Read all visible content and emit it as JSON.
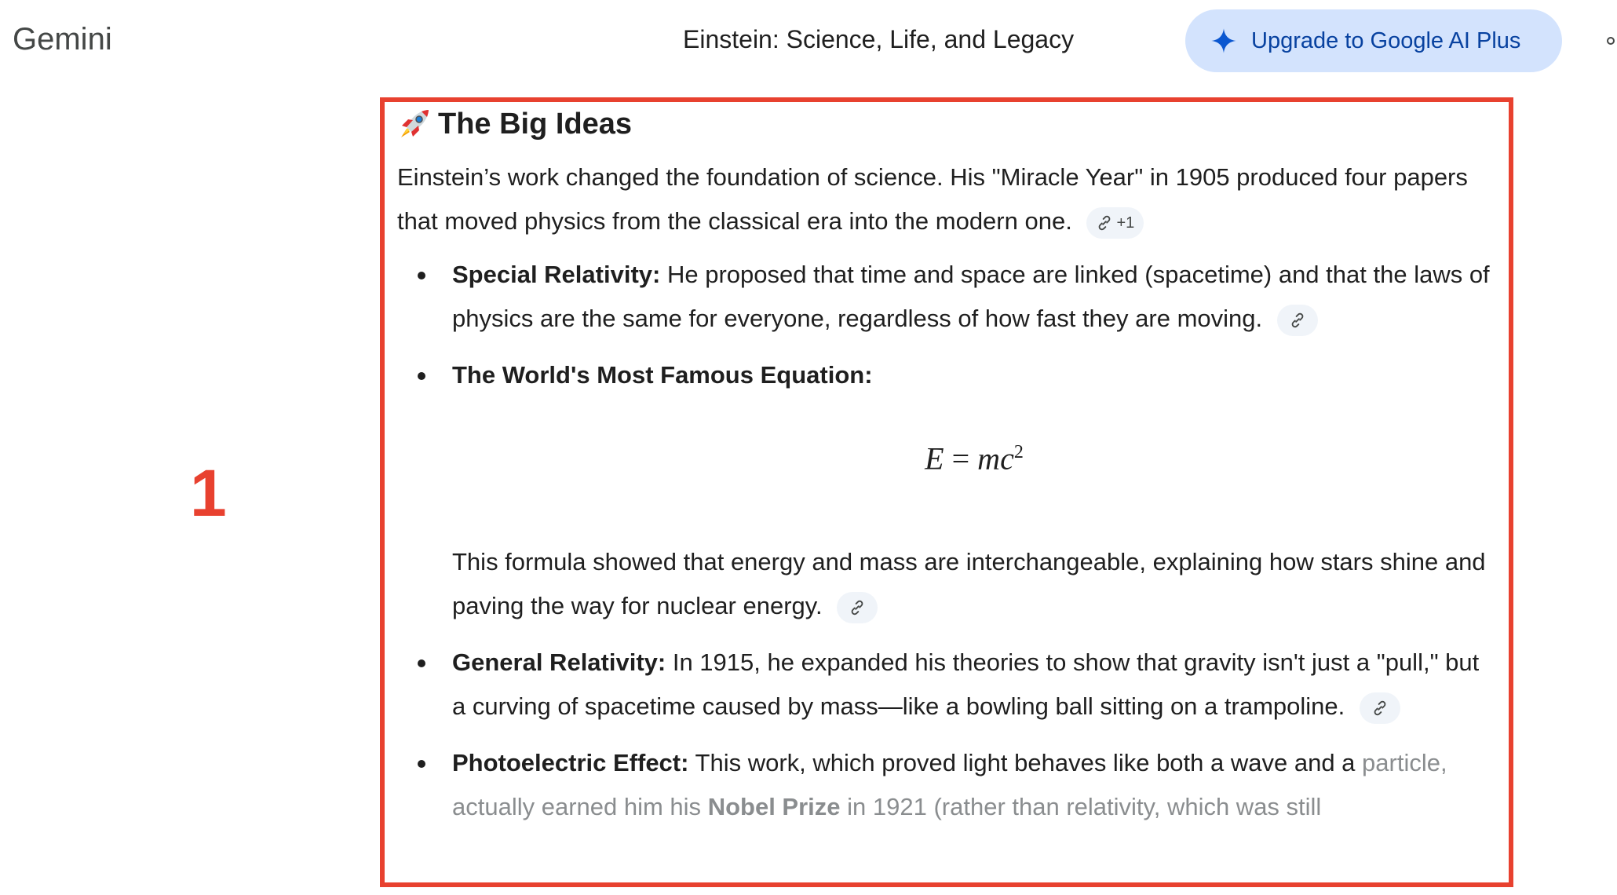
{
  "header": {
    "app_name": "Gemini",
    "conversation_title": "Einstein: Science, Life, and Legacy",
    "upgrade_button_label": "Upgrade to Google AI Plus"
  },
  "annotation": {
    "marker_label": "1",
    "box_color": "#e8412f"
  },
  "section": {
    "emoji_icon": "rocket-icon",
    "heading": "The Big Ideas",
    "intro": "Einstein’s work changed the foundation of science. His \"Miracle Year\" in 1905 produced four papers that moved physics from the classical era into the modern one.",
    "intro_source_extra": "+1"
  },
  "points": [
    {
      "title": "Special Relativity:",
      "text": "He proposed that time and space are linked (spacetime) and that the laws of physics are the same for everyone, regardless of how fast they are moving."
    },
    {
      "title": "The World's Most Famous Equation:",
      "equation": {
        "lhs": "E",
        "eq": "=",
        "m": "m",
        "c": "c",
        "exp": "2"
      },
      "text": "This formula showed that energy and mass are interchangeable, explaining how stars shine and paving the way for nuclear energy."
    },
    {
      "title": "General Relativity:",
      "text": "In 1915, he expanded his theories to show that gravity isn't just a \"pull,\" but a curving of spacetime caused by mass—like a bowling ball sitting on a trampoline."
    },
    {
      "title": "Photoelectric Effect:",
      "text": "This work, which proved light behaves like both a wave and a",
      "text_faded_1": "particle, actually earned him his",
      "text_faded_bold": "Nobel Prize",
      "text_faded_2": "in 1921 (rather than relativity, which was still"
    }
  ],
  "colors": {
    "accent_button_bg": "#d3e3fd",
    "accent_button_text": "#0842a0",
    "chip_bg": "#f0f4f9"
  }
}
